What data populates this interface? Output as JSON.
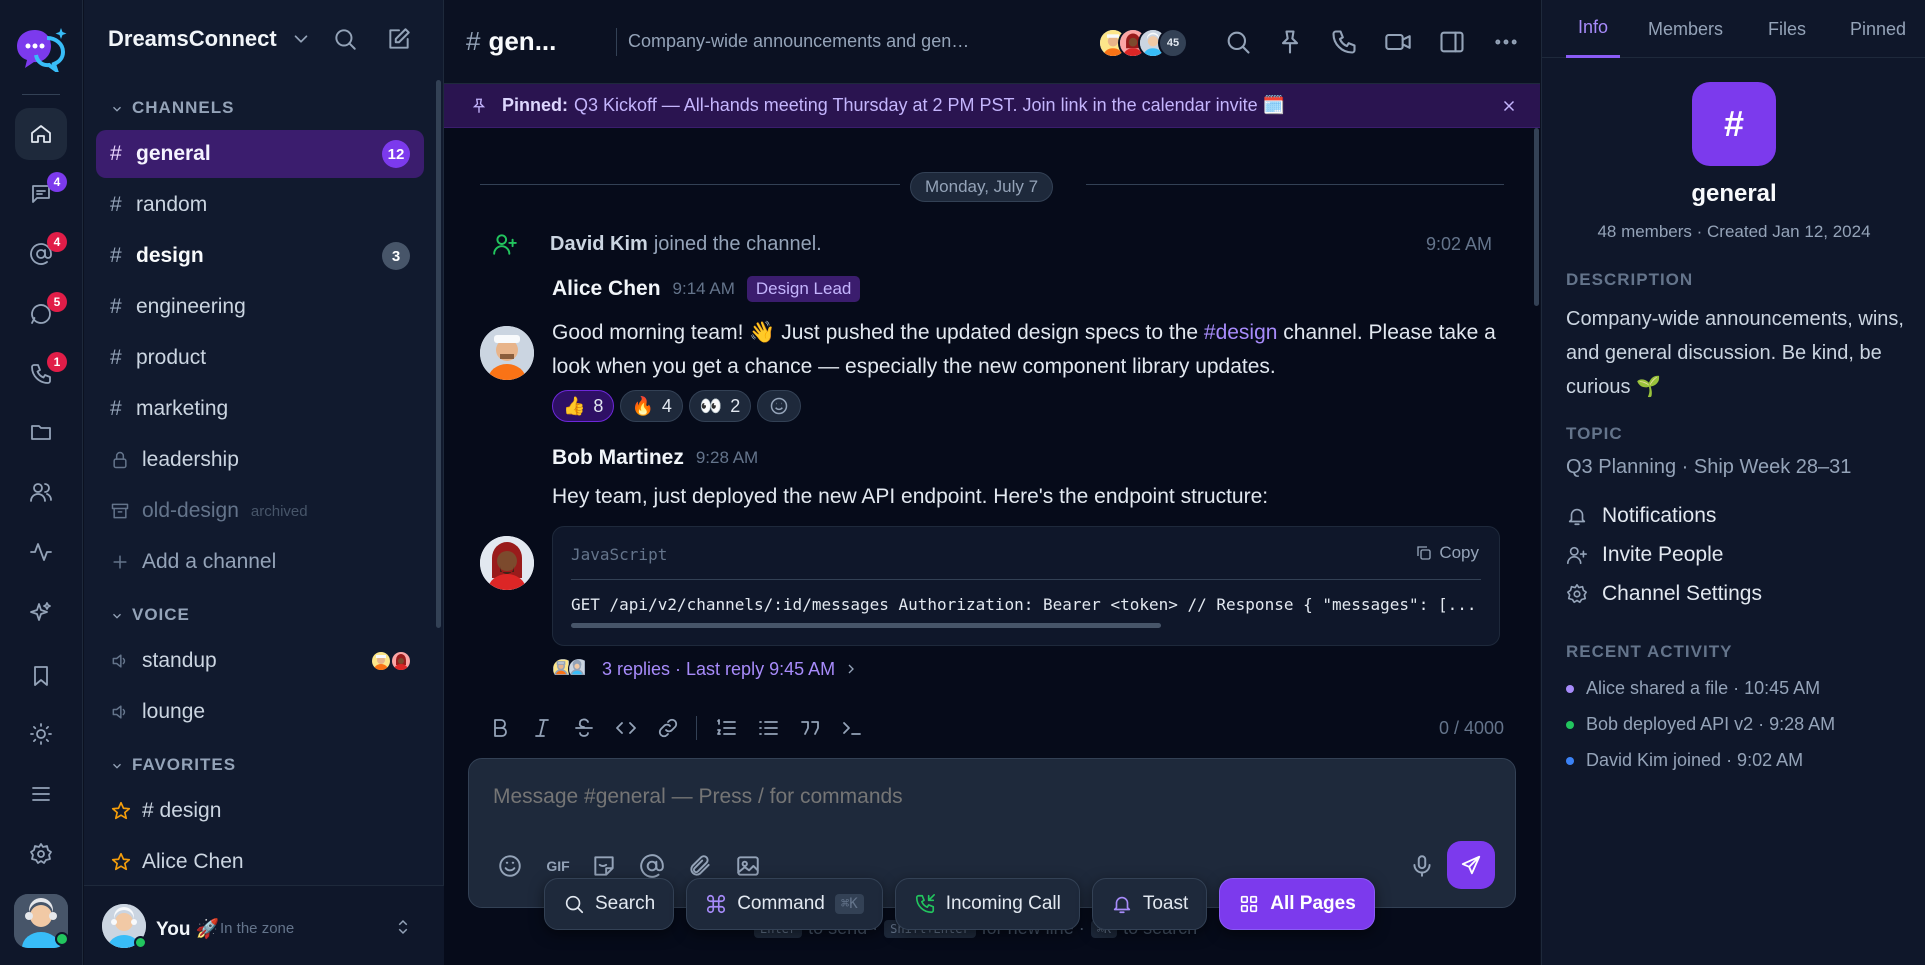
{
  "workspace": {
    "name": "DreamsConnect"
  },
  "rail": {
    "badges": {
      "threads": "4",
      "mentions": "4",
      "dms": "5",
      "calls": "1"
    }
  },
  "sidebar": {
    "channels_header": "CHANNELS",
    "channels": [
      {
        "name": "general",
        "badge": "12"
      },
      {
        "name": "random"
      },
      {
        "name": "design",
        "badge": "3"
      },
      {
        "name": "engineering"
      },
      {
        "name": "product"
      },
      {
        "name": "marketing"
      },
      {
        "name": "leadership"
      },
      {
        "name": "old-design",
        "tag": "archived"
      }
    ],
    "add_channel": "Add a channel",
    "voice_header": "VOICE",
    "voice": [
      {
        "name": "standup"
      },
      {
        "name": "lounge"
      }
    ],
    "favorites_header": "FAVORITES",
    "favorites": [
      {
        "name": "# design"
      },
      {
        "name": "Alice Chen"
      }
    ],
    "me": {
      "name": "You 🚀",
      "status": "In the zone"
    }
  },
  "topbar": {
    "hash": "#",
    "channel": "gen...",
    "description": "Company-wide announcements and general discussion",
    "member_count": "45"
  },
  "pinned": {
    "label": "Pinned:",
    "text": "Q3 Kickoff — All-hands meeting Thursday at 2 PM PST. Join link in the calendar invite 🗓️"
  },
  "messages": {
    "date": "Monday, July 7",
    "system": {
      "name": "David Kim",
      "text": "joined the channel.",
      "time": "9:02 AM"
    },
    "alice": {
      "author": "Alice Chen",
      "time": "9:14 AM",
      "role": "Design Lead",
      "text_a": "Good morning team! 👋 Just pushed the updated design specs to the ",
      "link": "#design",
      "text_b": " channel. Please take a look when you get a chance — especially the new component library updates.",
      "reactions": [
        {
          "emoji": "👍",
          "count": "8"
        },
        {
          "emoji": "🔥",
          "count": "4"
        },
        {
          "emoji": "👀",
          "count": "2"
        }
      ]
    },
    "bob": {
      "author": "Bob Martinez",
      "time": "9:28 AM",
      "text": "Hey team, just deployed the new API endpoint. Here's the endpoint structure:",
      "code_lang": "JavaScript",
      "copy_label": "Copy",
      "code": "GET /api/v2/channels/:id/messages Authorization: Bearer <token> // Response { \"messages\": [...",
      "thread": "3 replies · Last reply 9:45 AM"
    }
  },
  "composer": {
    "char_count": "0 / 4000",
    "placeholder": "Message #general — Press / for commands",
    "gif": "GIF",
    "hint_enter": "Enter",
    "hint_send": "to send ·",
    "hint_shift": "Shift+Enter",
    "hint_newline": "for new line ·",
    "hint_k": "⌘K",
    "hint_search": "to search"
  },
  "dock": {
    "search": "Search",
    "command": "Command",
    "command_kbd": "⌘K",
    "call": "Incoming Call",
    "toast": "Toast",
    "all_pages": "All Pages"
  },
  "panel": {
    "tabs": [
      "Info",
      "Members",
      "Files",
      "Pinned"
    ],
    "icon": "#",
    "name": "general",
    "meta": "48 members · Created Jan 12, 2024",
    "description_label": "DESCRIPTION",
    "description": "Company-wide announcements, wins, and general discussion. Be kind, be curious 🌱",
    "topic_label": "TOPIC",
    "topic": "Q3 Planning · Ship Week 28–31",
    "actions": [
      "Notifications",
      "Invite People",
      "Channel Settings"
    ],
    "recent_label": "RECENT ACTIVITY",
    "recent": [
      {
        "text": "Alice shared a file · 10:45 AM",
        "color": "#a78bfa"
      },
      {
        "text": "Bob deployed API v2 · 9:28 AM",
        "color": "#22c55e"
      },
      {
        "text": "David Kim joined · 9:02 AM",
        "color": "#3b82f6"
      }
    ]
  },
  "colors": {
    "accent": "#7c3aed",
    "online": "#22c55e",
    "alert": "#e11d48"
  }
}
